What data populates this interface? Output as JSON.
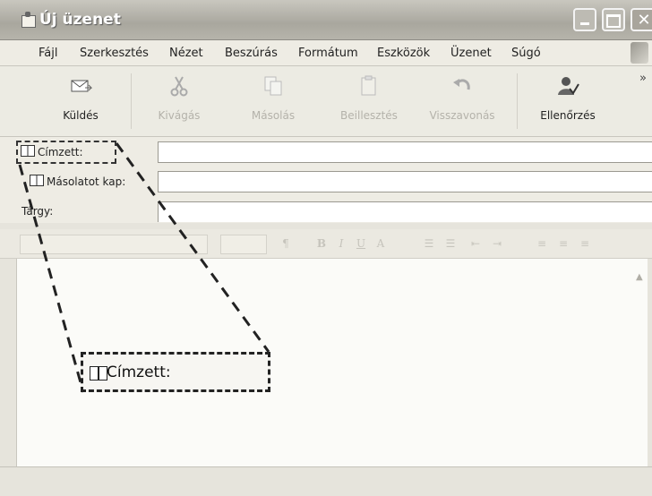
{
  "window": {
    "title": "Új üzenet"
  },
  "menu": [
    "Fájl",
    "Szerkesztés",
    "Nézet",
    "Beszúrás",
    "Formátum",
    "Eszközök",
    "Üzenet",
    "Súgó"
  ],
  "toolbar": {
    "send": "Küldés",
    "cut": "Kivágás",
    "copy": "Másolás",
    "paste": "Beillesztés",
    "undo": "Visszavonás",
    "check": "Ellenőrzés",
    "more": "»"
  },
  "fields": {
    "to_label": "Címzett:",
    "cc_label": "Másolatot kap:",
    "subject_label": "Tárgy:"
  },
  "format": {
    "bold": "B",
    "italic": "I",
    "underline": "U",
    "color": "A"
  },
  "callout": {
    "label": "Címzett:"
  }
}
